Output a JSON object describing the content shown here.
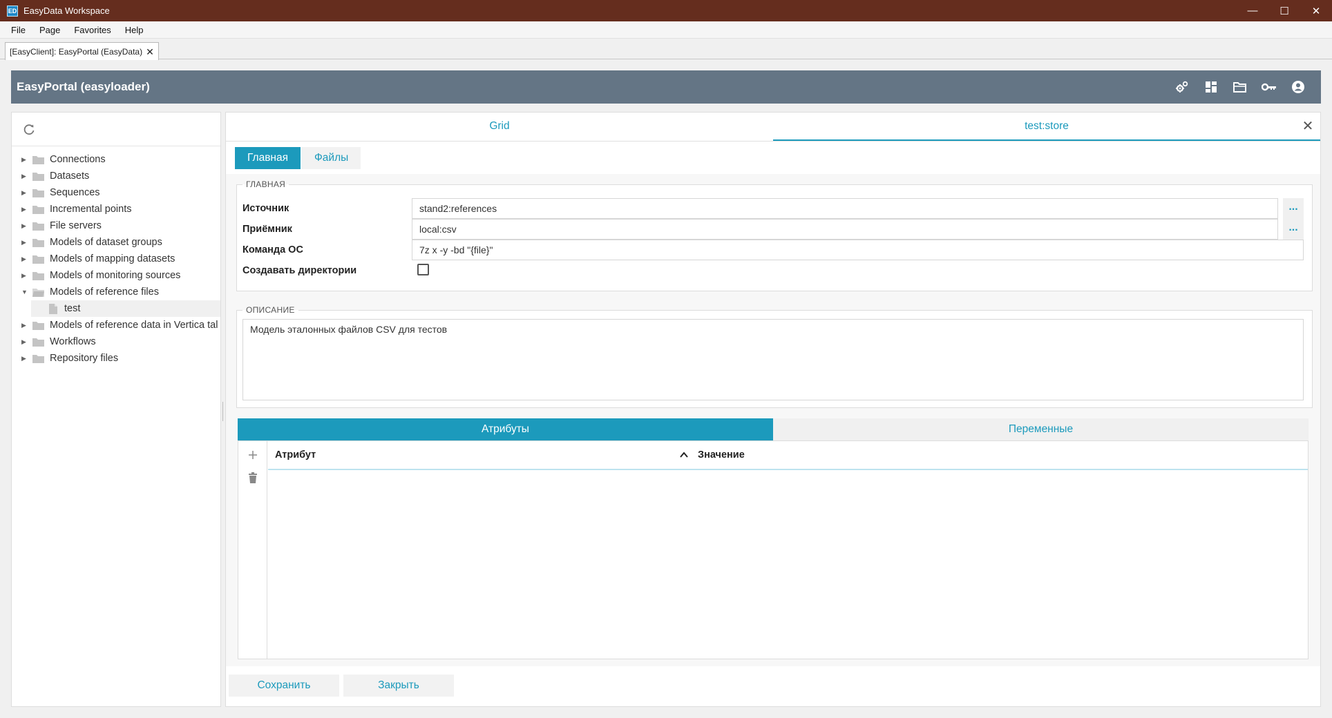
{
  "window": {
    "icon_text": "ED",
    "title": "EasyData Workspace",
    "min_glyph": "—",
    "max_glyph": "☐",
    "close_glyph": "✕"
  },
  "menu": [
    "File",
    "Page",
    "Favorites",
    "Help"
  ],
  "doc_tab": {
    "label": "[EasyClient]: EasyPortal (EasyData)",
    "close_glyph": "✕"
  },
  "header": {
    "title": "EasyPortal (easyloader)",
    "icons": [
      "settings-gears-icon",
      "dashboard-icon",
      "folder-open-icon",
      "key-icon",
      "account-circle-icon"
    ]
  },
  "tree": [
    {
      "label": "Connections",
      "expanded": false
    },
    {
      "label": "Datasets",
      "expanded": false
    },
    {
      "label": "Sequences",
      "expanded": false
    },
    {
      "label": "Incremental points",
      "expanded": false
    },
    {
      "label": "File servers",
      "expanded": false
    },
    {
      "label": "Models of dataset groups",
      "expanded": false
    },
    {
      "label": "Models of mapping datasets",
      "expanded": false
    },
    {
      "label": "Models of monitoring sources",
      "expanded": false
    },
    {
      "label": "Models of reference files",
      "expanded": true,
      "children": [
        "test"
      ]
    },
    {
      "label": "Models of reference data in Vertica tal",
      "expanded": false
    },
    {
      "label": "Workflows",
      "expanded": false
    },
    {
      "label": "Repository files",
      "expanded": false
    }
  ],
  "tabs": [
    {
      "label": "Grid",
      "active": false
    },
    {
      "label": "test:store",
      "active": true
    }
  ],
  "subtabs": [
    {
      "label": "Главная",
      "active": true
    },
    {
      "label": "Файлы",
      "active": false
    }
  ],
  "main_section": {
    "legend": "Главная",
    "source_label": "Источник",
    "source_value": "stand2:references",
    "receiver_label": "Приёмник",
    "receiver_value": "local:csv",
    "command_label": "Команда ОС",
    "command_value": "7z x -y -bd \"{file}\"",
    "create_dirs_label": "Создавать директории",
    "create_dirs_checked": false,
    "dots_label": "..."
  },
  "description_section": {
    "legend": "Описание",
    "text": "Модель эталонных файлов CSV для тестов"
  },
  "attr_tabs": [
    {
      "label": "Атрибуты",
      "active": true
    },
    {
      "label": "Переменные",
      "active": false
    }
  ],
  "grid": {
    "columns": [
      "Атрибут",
      "Значение"
    ],
    "rows": []
  },
  "footer": {
    "save_label": "Сохранить",
    "close_label": "Закрыть"
  },
  "colors": {
    "titlebar": "#652d1e",
    "header": "#647585",
    "accent": "#1c9abc"
  }
}
